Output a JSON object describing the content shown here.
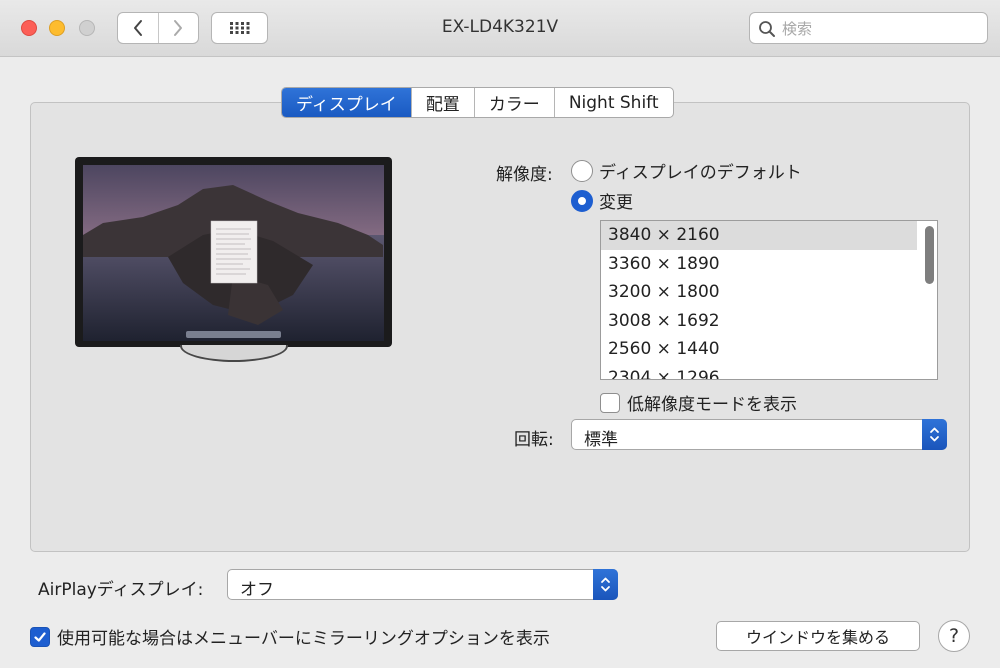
{
  "window": {
    "title": "EX-LD4K321V"
  },
  "toolbar": {
    "search_placeholder": "検索"
  },
  "tabs": [
    {
      "label": "ディスプレイ",
      "active": true
    },
    {
      "label": "配置",
      "active": false
    },
    {
      "label": "カラー",
      "active": false
    },
    {
      "label": "Night Shift",
      "active": false
    }
  ],
  "resolution": {
    "label": "解像度:",
    "option_default": "ディスプレイのデフォルト",
    "option_scaled": "変更",
    "selected_option": "変更",
    "list": [
      "3840 × 2160",
      "3360 × 1890",
      "3200 × 1800",
      "3008 × 1692",
      "2560 × 1440",
      "2304 × 1296"
    ],
    "selected_index": 0,
    "low_res_label": "低解像度モードを表示",
    "low_res_checked": false
  },
  "rotation": {
    "label": "回転:",
    "value": "標準"
  },
  "airplay": {
    "label": "AirPlayディスプレイ:",
    "value": "オフ"
  },
  "mirroring": {
    "label": "使用可能な場合はメニューバーにミラーリングオプションを表示",
    "checked": true
  },
  "gather_button": "ウインドウを集める",
  "help": "?",
  "colors": {
    "accent": "#1d5ed0",
    "panel": "#e3e3e3",
    "close": "#fc5f57",
    "minimize": "#fdbc2e"
  }
}
